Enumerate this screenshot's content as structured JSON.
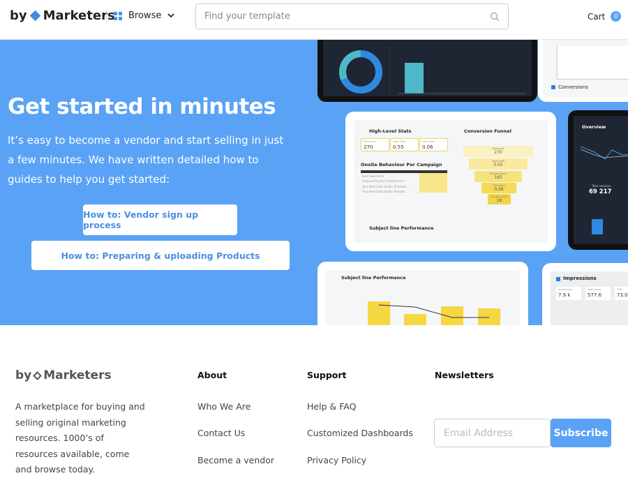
{
  "header": {
    "brand_by": "by",
    "brand_name": "Marketers",
    "browse_label": "Browse",
    "search_placeholder": "Find your template",
    "cart_label": "Cart",
    "cart_count": "0"
  },
  "hero": {
    "title": "Get started in minutes",
    "lead": "It’s easy to become a vendor and start selling in just a few minutes. We have written detailed how to guides to help you get started:",
    "buttons": [
      {
        "label": "How to: Vendor sign up process"
      },
      {
        "label": "How to: Preparing & uploading Products"
      }
    ],
    "background": "#5aa2f5"
  },
  "previews": {
    "conversions_title": "Conversions",
    "stats_title": "High-Level Stats",
    "stats": [
      {
        "label": "Delivered",
        "value": "270"
      },
      {
        "label": "Open Rate",
        "value": "0.55"
      },
      {
        "label": "Click Rate",
        "value": "0.06"
      }
    ],
    "onsite_title": "Onsite Behaviour Per Campaign",
    "onsite_rows": [
      "June Newsletter",
      "Featured Product (mobile tem...",
      "Your Next Data Studio Template...",
      "Your Next Data Studio Templat..."
    ],
    "funnel_title": "Conversion Funnel",
    "funnel": [
      {
        "label": "Delivered",
        "value": "270"
      },
      {
        "label": "Open Rate",
        "value": "0.55"
      },
      {
        "label": "Unique Opens",
        "value": "165"
      },
      {
        "label": "Click Rate",
        "value": "0.06"
      },
      {
        "label": "Unique Clicks",
        "value": "18"
      }
    ],
    "subject_title": "Subject line Performance",
    "overview_title": "Overview",
    "sessions_label": "Total sessions",
    "sessions_value": "69 217",
    "impressions_title": "Impressions",
    "impressions": [
      {
        "label": "Impressions",
        "value": "7.9 k"
      },
      {
        "label": "Total spent",
        "value": "577.6"
      },
      {
        "label": "CPM",
        "value": "73.0"
      }
    ]
  },
  "footer": {
    "brand_by": "by",
    "brand_name": "Marketers",
    "description": "A marketplace for buying and selling original marketing resources.  1000’s of resources available, come and browse today.",
    "about": {
      "title": "About",
      "links": [
        "Who We Are",
        "Contact Us",
        "Become a vendor"
      ]
    },
    "support": {
      "title": "Support",
      "links": [
        "Help & FAQ",
        "Customized Dashboards",
        "Privacy Policy"
      ]
    },
    "newsletter": {
      "title": "Newsletters",
      "email_placeholder": "Email Address",
      "subscribe_label": "Subscribe"
    }
  }
}
